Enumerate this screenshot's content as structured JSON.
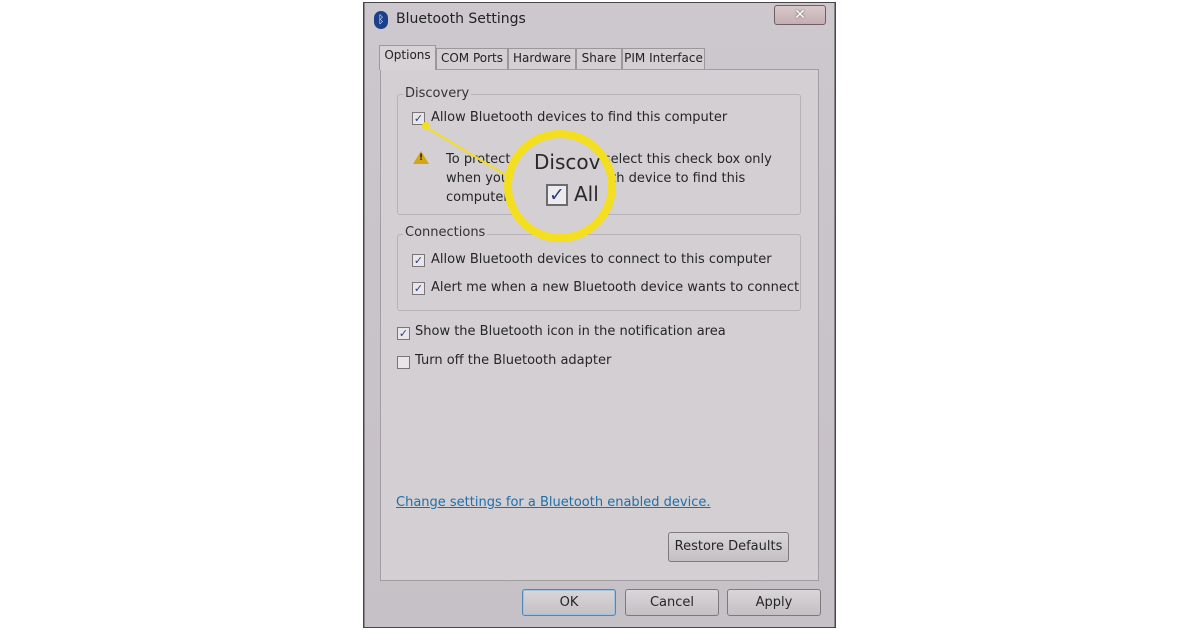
{
  "window": {
    "title": "Bluetooth Settings",
    "close_label": "✕"
  },
  "tabs": [
    "Options",
    "COM Ports",
    "Hardware",
    "Share",
    "PIM Interface"
  ],
  "discovery": {
    "title": "Discovery",
    "allow_find_label": "Allow Bluetooth devices to find this computer",
    "allow_find_checked": true,
    "warning_text": "To protect your privacy, select this check box only when you want a Bluetooth device to find this computer."
  },
  "connections": {
    "title": "Connections",
    "allow_connect_label": "Allow Bluetooth devices to connect to this computer",
    "allow_connect_checked": true,
    "alert_label": "Alert me when a new Bluetooth device wants to connect",
    "alert_checked": true
  },
  "options": {
    "show_icon_label": "Show the Bluetooth icon in the notification area",
    "show_icon_checked": true,
    "turn_off_label": "Turn off the Bluetooth adapter",
    "turn_off_checked": false
  },
  "link_text": "Change settings for a Bluetooth enabled device.",
  "buttons": {
    "restore_defaults": "Restore Defaults",
    "ok": "OK",
    "cancel": "Cancel",
    "apply": "Apply"
  },
  "zoom": {
    "heading_fragment": "Discov",
    "label_fragment": "All",
    "checkmark": "✓"
  },
  "colors": {
    "highlight": "#f3df20",
    "link": "#1f6fa8",
    "warning": "#d4a514"
  }
}
